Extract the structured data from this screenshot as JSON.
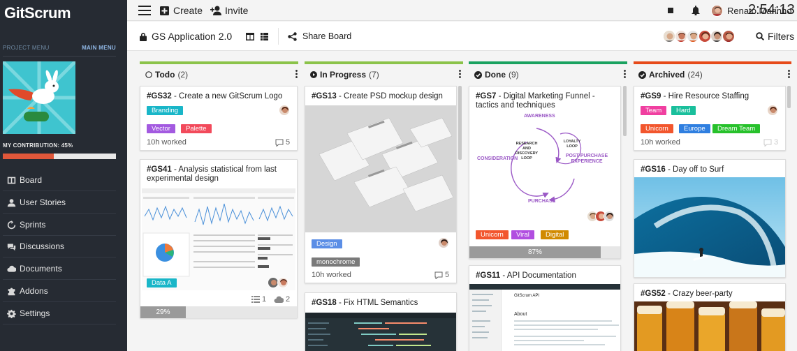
{
  "sidebar": {
    "logo": "GitScrum",
    "project_menu_label": "PROJECT MENU",
    "main_menu_label": "MAIN MENU",
    "contribution_label": "MY CONTRIBUTION: 45%",
    "contribution_value": 0.45,
    "items": [
      {
        "label": "Board",
        "icon": "board-icon"
      },
      {
        "label": "User Stories",
        "icon": "user-icon"
      },
      {
        "label": "Sprints",
        "icon": "sprint-icon"
      },
      {
        "label": "Discussions",
        "icon": "chat-icon"
      },
      {
        "label": "Documents",
        "icon": "cloud-icon"
      },
      {
        "label": "Addons",
        "icon": "puzzle-icon"
      },
      {
        "label": "Settings",
        "icon": "gear-icon"
      }
    ]
  },
  "topbar": {
    "create_label": "Create",
    "invite_label": "Invite",
    "timer": "2:54:13",
    "user_name": "Renato Marinho"
  },
  "header": {
    "board_title": "GS Application 2.0",
    "share_label": "Share Board",
    "filters_label": "Filters"
  },
  "columns": [
    {
      "title": "Todo",
      "count": "(2)",
      "color": "#8bc34a",
      "cards": [
        {
          "id": "#GS32",
          "title": " - Create a new GitScrum Logo",
          "tags": [
            "Branding",
            "Vector",
            "Palette"
          ],
          "worked": "10h worked",
          "comments": "5"
        },
        {
          "id": "#GS41",
          "title": " - Analysis statistical from last experimental design",
          "tags": [
            "Data A"
          ],
          "tasks": "1",
          "attachments": "2",
          "progress_label": "29%",
          "progress": 0.29
        }
      ]
    },
    {
      "title": "In Progress",
      "count": "(7)",
      "color": "#8bc34a",
      "cards": [
        {
          "id": "#GS13",
          "title": " - Create PSD mockup design",
          "tags": [
            "Design",
            "monochrome"
          ],
          "worked": "10h worked",
          "comments": "5"
        },
        {
          "id": "#GS18",
          "title": " - Fix HTML Semantics"
        }
      ]
    },
    {
      "title": "Done",
      "count": "(9)",
      "color": "#1aa260",
      "cards": [
        {
          "id": "#GS7",
          "title": " - Digital Marketing Funnel - tactics and techniques",
          "tags": [
            "Unicorn",
            "Viral",
            "Digital"
          ],
          "progress_label": "87%",
          "progress": 0.87,
          "diagram": {
            "awareness": "AWARENESS",
            "research": "RESEARCH AND",
            "discovery": "DISCOVERY",
            "loop": "LOOP",
            "loyalty": "LOYALTY",
            "loyalty_loop": "LOOP",
            "consideration": "CONSIDERATION",
            "post_purchase": "POST-PURCHASE",
            "experience": "EXPERIENCE",
            "purchase": "PURCHASE"
          }
        },
        {
          "id": "#GS11",
          "title": " - API Documentation",
          "doc": {
            "title": "GitScrum API",
            "about": "About"
          }
        }
      ]
    },
    {
      "title": "Archived",
      "count": "(24)",
      "color": "#e64a19",
      "cards": [
        {
          "id": "#GS9",
          "title": " - Hire Resource Staffing",
          "tags": [
            "Team",
            "Hard",
            "Unicorn",
            "Europe",
            "Dream Team"
          ],
          "worked": "10h worked",
          "comments": "3"
        },
        {
          "id": "#GS16",
          "title": " - Day off to Surf"
        },
        {
          "id": "#GS52",
          "title": " - Crazy beer-party"
        }
      ]
    }
  ],
  "colors": {
    "branding": "#19b6c8",
    "vector": "#a35ae0",
    "palette": "#f24a5b",
    "data_a": "#19b6c8",
    "design": "#5b8ee6",
    "monochrome": "#7a7a7a",
    "unicorn": "#f2562d",
    "viral": "#b14ee0",
    "digital": "#d18a00",
    "team": "#f03fa0",
    "hard": "#1abf9c",
    "europe": "#2f7fe0",
    "dream_team": "#27c12b"
  }
}
